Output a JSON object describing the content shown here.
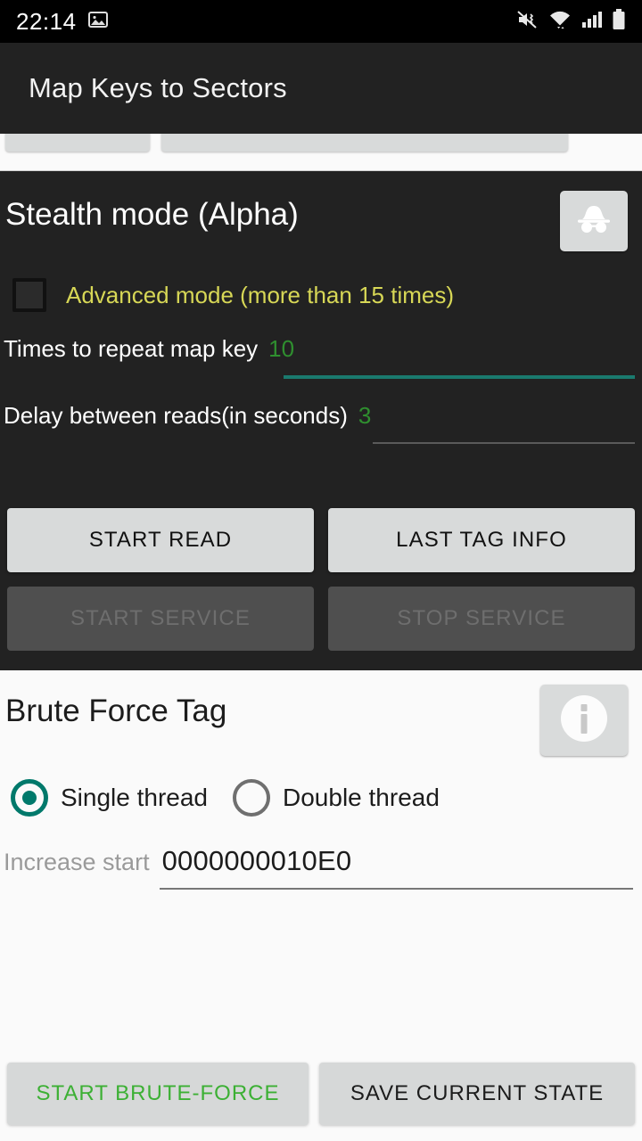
{
  "status_bar": {
    "time": "22:14",
    "icons": [
      "image-icon",
      "mute-vibrate-icon",
      "wifi-icon",
      "signal-icon",
      "battery-icon"
    ]
  },
  "app_bar": {
    "title": "Map Keys to Sectors"
  },
  "stealth_section": {
    "title": "Stealth mode (Alpha)",
    "incognito_button": "incognito-icon",
    "advanced_mode": {
      "label": "Advanced mode (more than 15 times)",
      "checked": false,
      "color": "#d7d756"
    },
    "repeat_field": {
      "label": "Times to repeat map key",
      "value": "10",
      "focused": true,
      "underline_color": "#1a7a6e"
    },
    "delay_field": {
      "label": "Delay between reads(in seconds)",
      "value": "3",
      "focused": false,
      "underline_color": "#5a5a5a"
    },
    "buttons": [
      {
        "label": "START READ",
        "enabled": true
      },
      {
        "label": "LAST TAG INFO",
        "enabled": true
      },
      {
        "label": "START SERVICE",
        "enabled": false
      },
      {
        "label": "STOP SERVICE",
        "enabled": false
      }
    ]
  },
  "brute_force_section": {
    "title": "Brute Force Tag",
    "info_button": "info-icon",
    "thread_options": [
      {
        "label": "Single thread",
        "selected": true
      },
      {
        "label": "Double thread",
        "selected": false
      }
    ],
    "increase_start": {
      "label": "Increase start",
      "value": "0000000010E0"
    },
    "buttons": [
      {
        "label": "START BRUTE-FORCE",
        "color": "#3cb034"
      },
      {
        "label": "SAVE CURRENT STATE",
        "color": "#1c1c1c"
      }
    ]
  },
  "theme": {
    "dark_bg": "#222222",
    "light_bg": "#fafafa",
    "accent_teal": "#00796b",
    "accent_green": "#2f8f2f"
  }
}
